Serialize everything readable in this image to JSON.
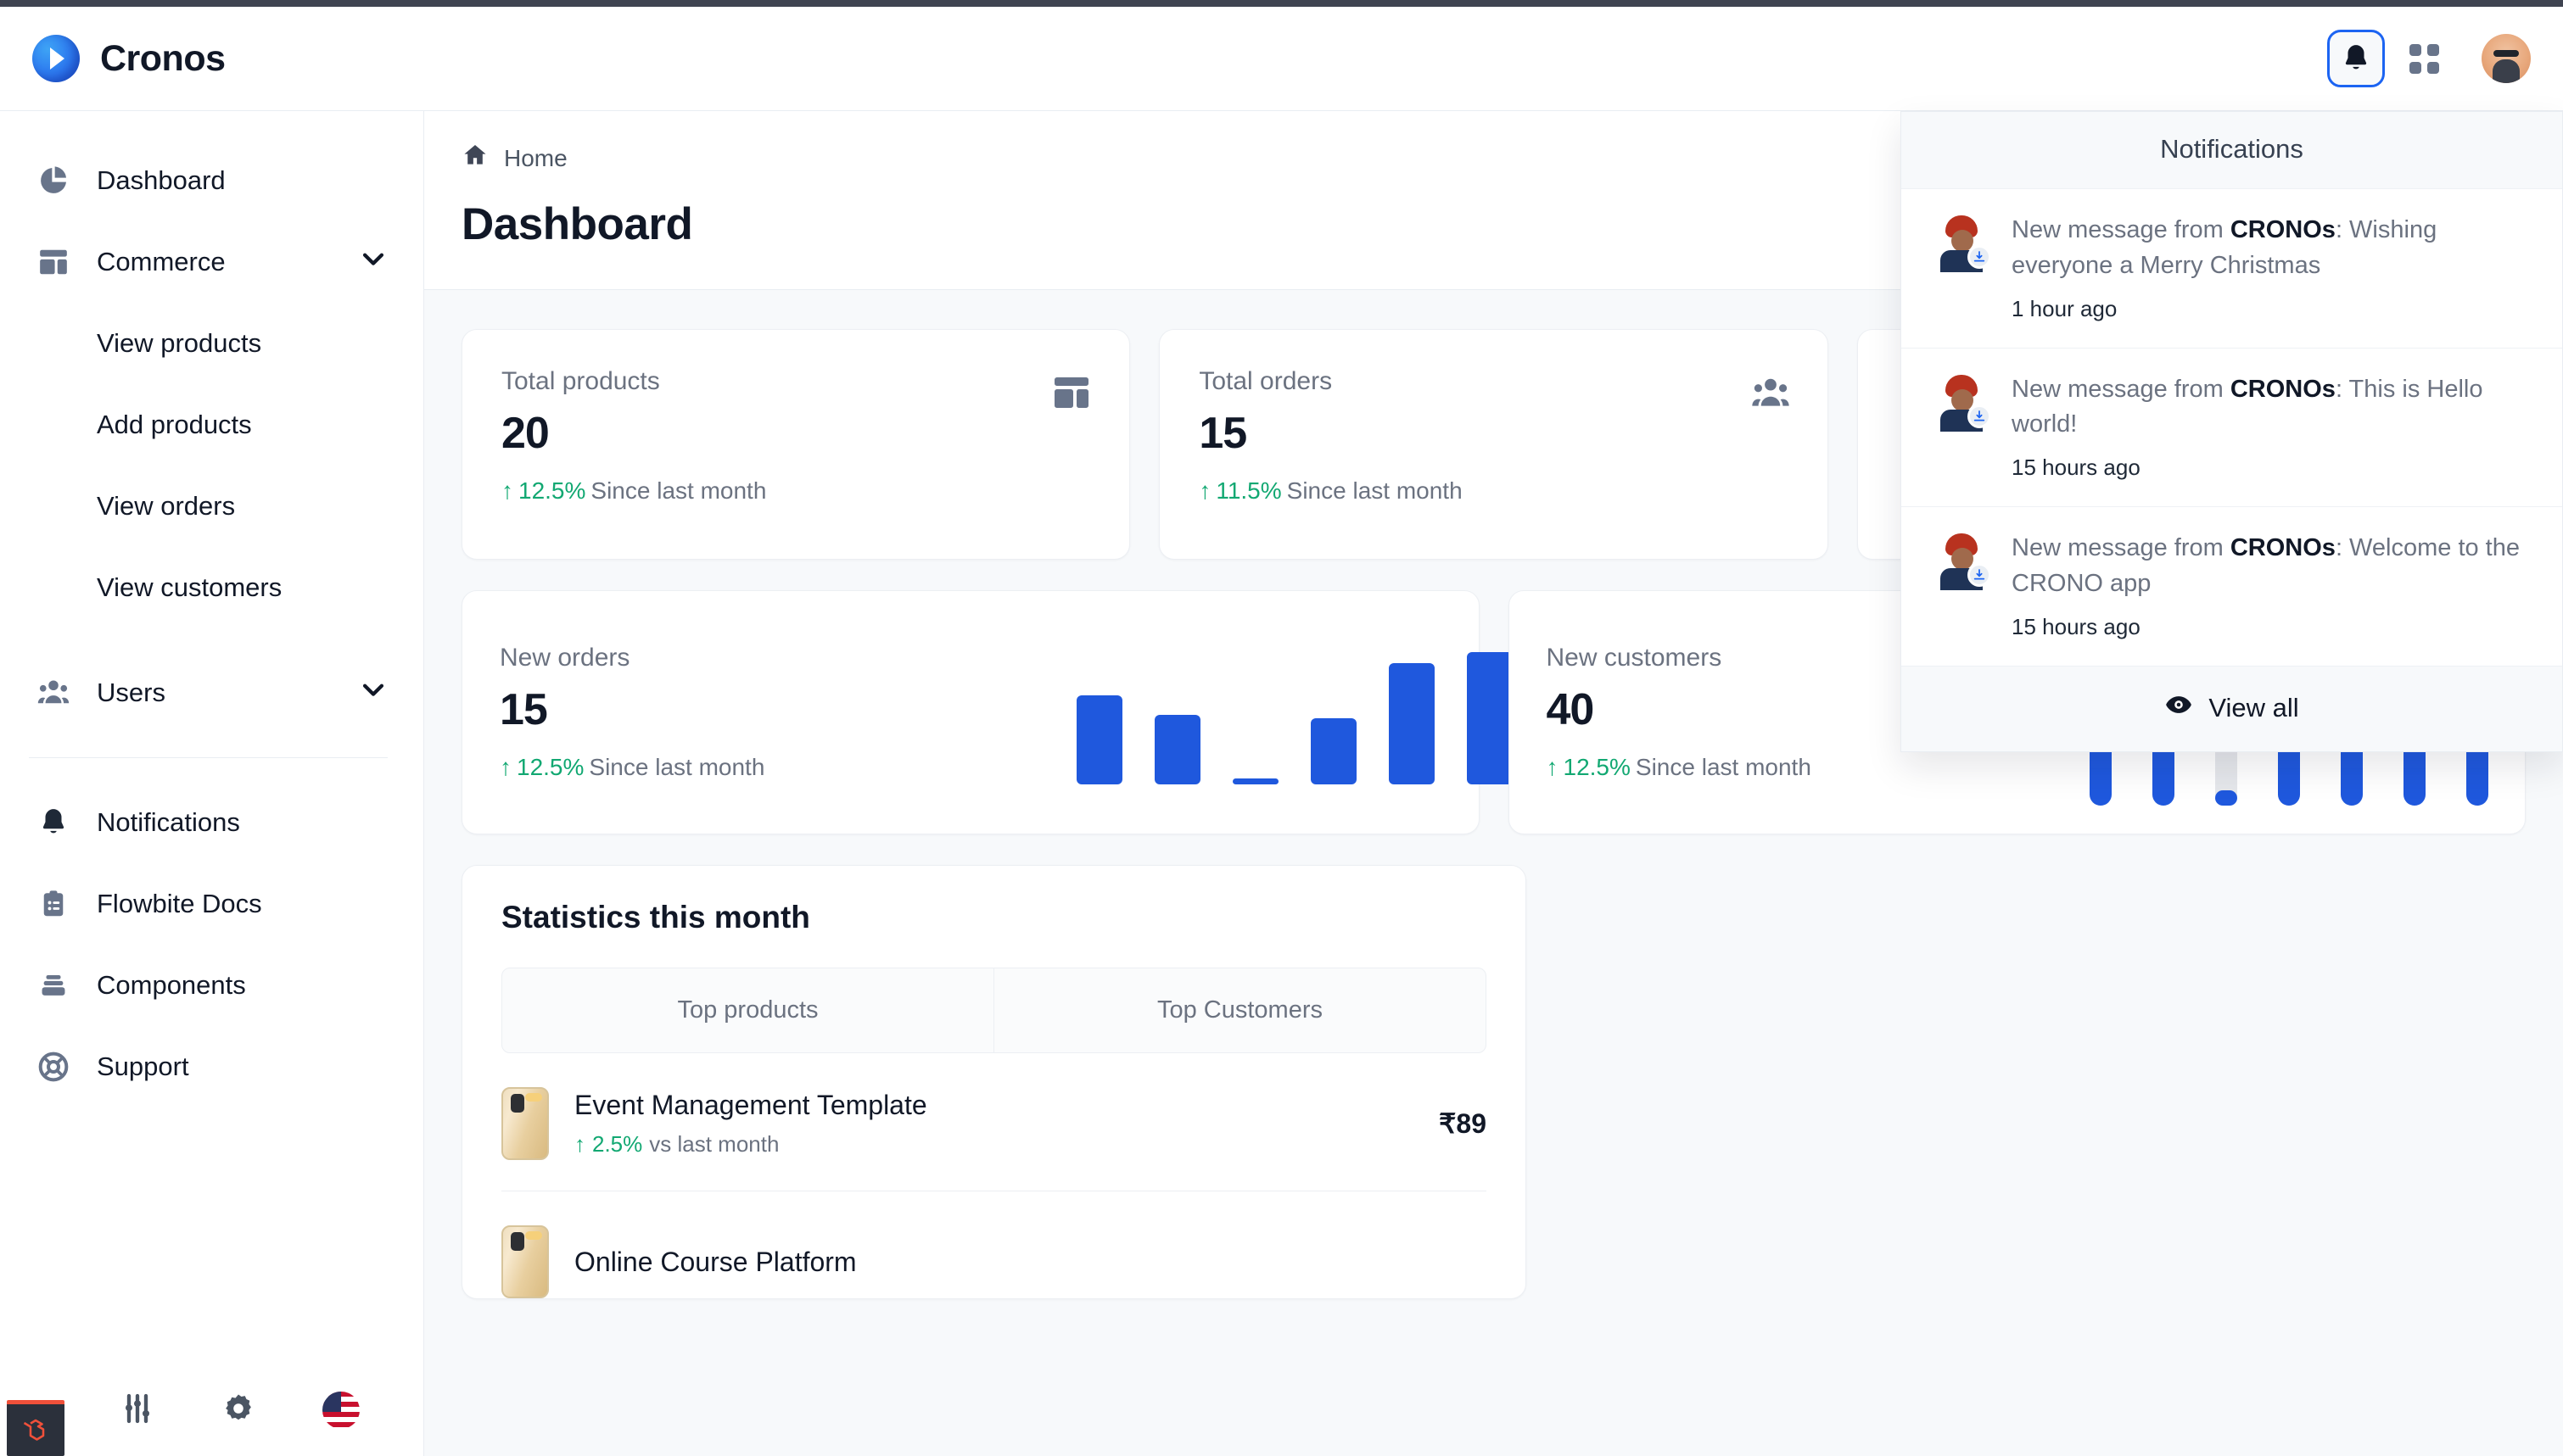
{
  "app": {
    "brand": "Cronos",
    "logo_icon": "play-circle-icon"
  },
  "header": {
    "bell_icon": "bell-icon",
    "apps_icon": "grid-apps-icon",
    "avatar_icon": "user-avatar"
  },
  "sidebar": {
    "items": [
      {
        "label": "Dashboard",
        "icon": "pie-chart-icon",
        "expandable": false
      },
      {
        "label": "Commerce",
        "icon": "layout-grid-icon",
        "expandable": true,
        "chevron": "chevron-down-icon"
      },
      {
        "label": "Users",
        "icon": "users-group-icon",
        "expandable": true,
        "chevron": "chevron-down-icon"
      },
      {
        "label": "Notifications",
        "icon": "bell-icon",
        "expandable": false
      },
      {
        "label": "Flowbite Docs",
        "icon": "clipboard-list-icon",
        "expandable": false
      },
      {
        "label": "Components",
        "icon": "stack-icon",
        "expandable": false
      },
      {
        "label": "Support",
        "icon": "lifebuoy-icon",
        "expandable": false
      }
    ],
    "commerce_children": [
      {
        "label": "View products"
      },
      {
        "label": "Add products"
      },
      {
        "label": "View orders"
      },
      {
        "label": "View customers"
      }
    ],
    "footer": {
      "laravel_icon": "laravel-logo-icon",
      "adjustments_icon": "sliders-icon",
      "settings_icon": "gear-icon",
      "language_icon": "us-flag-icon"
    }
  },
  "breadcrumb": {
    "home_icon": "home-icon",
    "home": "Home"
  },
  "page": {
    "title": "Dashboard"
  },
  "stat_cards": [
    {
      "label": "Total products",
      "value": "20",
      "delta": "12.5%",
      "delta_text": "Since last month",
      "icon": "layout-grid-icon",
      "arrow": "arrow-up-icon"
    },
    {
      "label": "Total orders",
      "value": "15",
      "delta": "11.5%",
      "delta_text": "Since last month",
      "icon": "users-group-icon",
      "arrow": "arrow-up-icon"
    },
    {
      "label": "",
      "value": "",
      "delta": "",
      "delta_text": "",
      "icon": "",
      "arrow": ""
    }
  ],
  "charts": [
    {
      "label": "New orders",
      "value": "15",
      "delta": "12.5%",
      "delta_text": "Since last month",
      "arrow": "arrow-up-icon"
    },
    {
      "label": "New customers",
      "value": "40",
      "delta": "12.5%",
      "delta_text": "Since last month",
      "arrow": "arrow-up-icon"
    }
  ],
  "statistics": {
    "title": "Statistics this month",
    "tabs": [
      {
        "label": "Top products"
      },
      {
        "label": "Top Customers"
      }
    ],
    "products": [
      {
        "name": "Event Management Template",
        "delta": "2.5%",
        "delta_text": "vs last month",
        "price": "₹89",
        "arrow": "arrow-up-icon",
        "thumb": "iphone-gold-thumbnail"
      },
      {
        "name": "Online Course Platform",
        "delta": "",
        "delta_text": "",
        "price": "",
        "arrow": "",
        "thumb": "iphone-gold-thumbnail"
      }
    ]
  },
  "notifications": {
    "title": "Notifications",
    "items": [
      {
        "prefix": "New message from ",
        "sender": "CRONOs",
        "body": ": Wishing everyone a Merry Christmas",
        "time": "1 hour ago",
        "avatar": "user-avatar",
        "badge": "download-badge-icon"
      },
      {
        "prefix": "New message from ",
        "sender": "CRONOs",
        "body": ": This is Hello world!",
        "time": "15 hours ago",
        "avatar": "user-avatar",
        "badge": "download-badge-icon"
      },
      {
        "prefix": "New message from ",
        "sender": "CRONOs",
        "body": ": Welcome to the CRONO app",
        "time": "15 hours ago",
        "avatar": "user-avatar",
        "badge": "download-badge-icon"
      }
    ],
    "view_all": "View all",
    "view_all_icon": "eye-icon"
  },
  "colors": {
    "accent": "#1c64f2",
    "bar": "#1f58dd",
    "bar_track": "#e5e7eb",
    "positive": "#12a872",
    "page_bg": "#f7f9fb",
    "icon_grey": "#68748a"
  },
  "chart_data": [
    {
      "type": "bar",
      "title": "New orders",
      "categories": [
        "1",
        "2",
        "3",
        "4",
        "5",
        "6",
        "7"
      ],
      "values": [
        62,
        48,
        4,
        46,
        84,
        92,
        30
      ],
      "ylim": [
        0,
        100
      ],
      "xlabel": "",
      "ylabel": "",
      "grid": false,
      "legend": false
    },
    {
      "type": "bar",
      "title": "New customers",
      "categories": [
        "1",
        "2",
        "3",
        "4",
        "5",
        "6",
        "7"
      ],
      "values": [
        68,
        38,
        8,
        85,
        85,
        100,
        50
      ],
      "ylim": [
        0,
        100
      ],
      "xlabel": "",
      "ylabel": "",
      "grid": false,
      "legend": false,
      "note": "rounded bars over full-height grey tracks"
    }
  ]
}
